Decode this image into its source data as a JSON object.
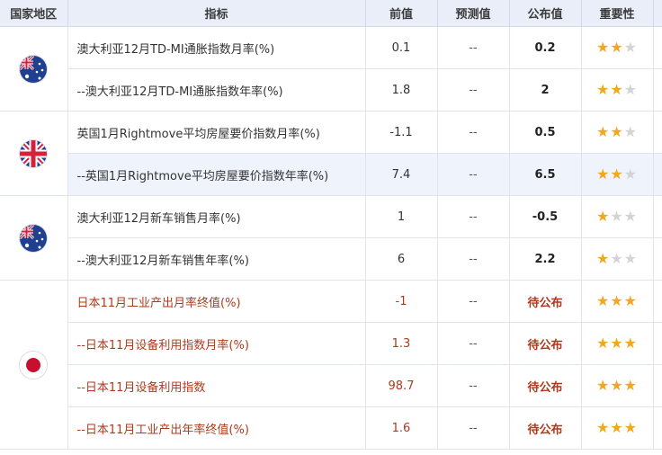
{
  "headers": {
    "country": "国家地区",
    "indicator": "指标",
    "previous": "前值",
    "forecast": "预测值",
    "actual": "公布值",
    "importance": "重要性"
  },
  "groups": [
    {
      "flag_icon": "australia-flag-icon",
      "rows": [
        {
          "indicator": "澳大利亚12月TD-MI通胀指数月率(%)",
          "previous": "0.1",
          "forecast": "--",
          "actual": "0.2",
          "stars": 2,
          "pending": false
        },
        {
          "indicator": "--澳大利亚12月TD-MI通胀指数年率(%)",
          "previous": "1.8",
          "forecast": "--",
          "actual": "2",
          "stars": 2,
          "pending": false
        }
      ]
    },
    {
      "flag_icon": "uk-flag-icon",
      "rows": [
        {
          "indicator": "英国1月Rightmove平均房屋要价指数月率(%)",
          "previous": "-1.1",
          "forecast": "--",
          "actual": "0.5",
          "stars": 2,
          "pending": false
        },
        {
          "indicator": "--英国1月Rightmove平均房屋要价指数年率(%)",
          "previous": "7.4",
          "forecast": "--",
          "actual": "6.5",
          "stars": 2,
          "pending": false,
          "highlighted": true
        }
      ]
    },
    {
      "flag_icon": "australia-flag-icon",
      "rows": [
        {
          "indicator": "澳大利亚12月新车销售月率(%)",
          "previous": "1",
          "forecast": "--",
          "actual": "-0.5",
          "stars": 1,
          "pending": false
        },
        {
          "indicator": "--澳大利亚12月新车销售年率(%)",
          "previous": "6",
          "forecast": "--",
          "actual": "2.2",
          "stars": 1,
          "pending": false
        }
      ]
    },
    {
      "flag_icon": "japan-flag-icon",
      "rows": [
        {
          "indicator": "日本11月工业产出月率终值(%)",
          "previous": "-1",
          "forecast": "--",
          "actual": "待公布",
          "stars": 3,
          "pending": true
        },
        {
          "indicator": "--日本11月设备利用指数月率(%)",
          "previous": "1.3",
          "forecast": "--",
          "actual": "待公布",
          "stars": 3,
          "pending": true
        },
        {
          "indicator": "--日本11月设备利用指数",
          "previous": "98.7",
          "forecast": "--",
          "actual": "待公布",
          "stars": 3,
          "pending": true
        },
        {
          "indicator": "--日本11月工业产出年率终值(%)",
          "previous": "1.6",
          "forecast": "--",
          "actual": "待公布",
          "stars": 3,
          "pending": true
        }
      ]
    }
  ],
  "colors": {
    "header_bg": "#e9eef9",
    "pending_text": "#b03a1e",
    "star_on": "#f2a81d",
    "star_off": "#d4d4d4",
    "highlight_row": "#eef3fc"
  }
}
